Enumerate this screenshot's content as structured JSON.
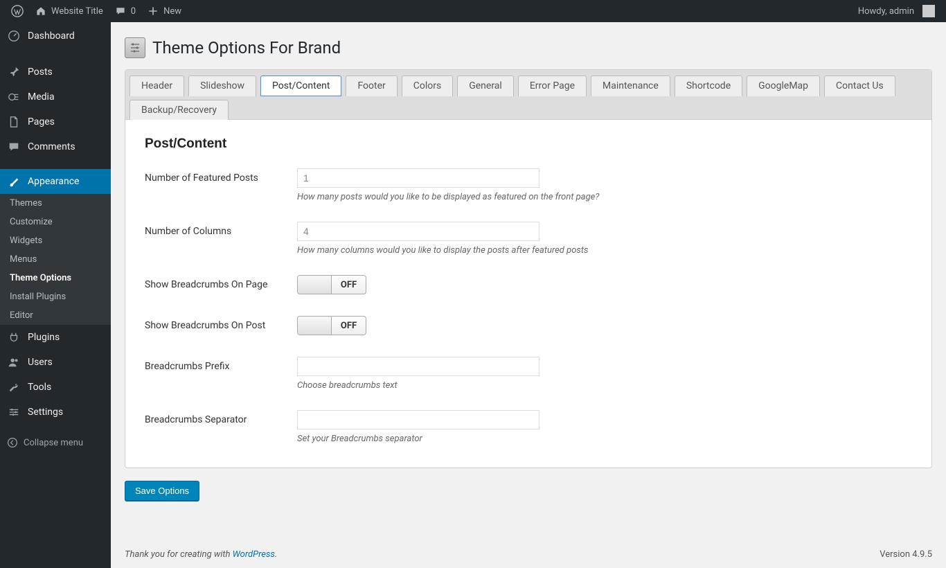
{
  "adminbar": {
    "site_title": "Website Title",
    "comments_count": "0",
    "new_label": "New",
    "howdy": "Howdy, admin"
  },
  "sidebar": {
    "items": [
      {
        "label": "Dashboard"
      },
      {
        "label": "Posts"
      },
      {
        "label": "Media"
      },
      {
        "label": "Pages"
      },
      {
        "label": "Comments"
      },
      {
        "label": "Appearance"
      },
      {
        "label": "Plugins"
      },
      {
        "label": "Users"
      },
      {
        "label": "Tools"
      },
      {
        "label": "Settings"
      }
    ],
    "appearance_sub": [
      {
        "label": "Themes"
      },
      {
        "label": "Customize"
      },
      {
        "label": "Widgets"
      },
      {
        "label": "Menus"
      },
      {
        "label": "Theme Options"
      },
      {
        "label": "Install Plugins"
      },
      {
        "label": "Editor"
      }
    ],
    "collapse_label": "Collapse menu"
  },
  "page": {
    "title": "Theme Options For Brand",
    "tabs": [
      "Header",
      "Slideshow",
      "Post/Content",
      "Footer",
      "Colors",
      "General",
      "Error Page",
      "Maintenance",
      "Shortcode",
      "GoogleMap",
      "Contact Us",
      "Backup/Recovery"
    ],
    "active_tab_index": 2,
    "section_title": "Post/Content",
    "fields": {
      "featured_posts": {
        "label": "Number of Featured Posts",
        "placeholder": "1",
        "value": "",
        "help": "How many posts would you like to be displayed as featured on the front page?"
      },
      "columns": {
        "label": "Number of Columns",
        "placeholder": "4",
        "value": "",
        "help": "How many columns would you like to display the posts after featured posts"
      },
      "breadcrumbs_page": {
        "label": "Show Breadcrumbs On Page",
        "state": "OFF"
      },
      "breadcrumbs_post": {
        "label": "Show Breadcrumbs On Post",
        "state": "OFF"
      },
      "breadcrumbs_prefix": {
        "label": "Breadcrumbs Prefix",
        "value": "",
        "help": "Choose breadcrumbs text"
      },
      "breadcrumbs_separator": {
        "label": "Breadcrumbs Separator",
        "value": "",
        "help": "Set your Breadcrumbs separator"
      }
    },
    "save_button": "Save Options"
  },
  "footer": {
    "thank_you_prefix": "Thank you for creating with ",
    "wp_link": "WordPress",
    "version": "Version 4.9.5"
  }
}
